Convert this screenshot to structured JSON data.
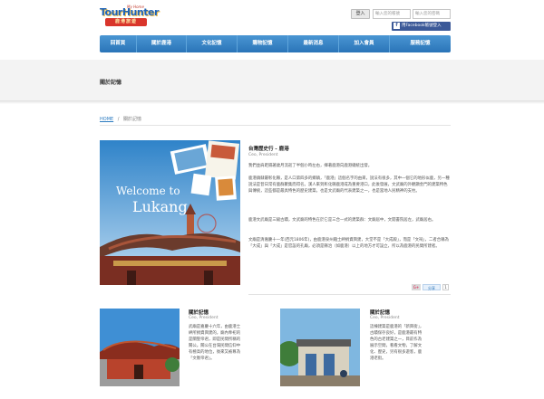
{
  "header": {
    "logo": {
      "main": "TourHunter",
      "tag": "My Home",
      "sub": "鹿港旅遊"
    },
    "login_button": "登入",
    "account_placeholder": "輸入您的帳號",
    "password_placeholder": "輸入您的密碼",
    "facebook_login": "用Facebook帳號登入"
  },
  "nav": {
    "items": [
      "回首頁",
      "關於鹿港",
      "文化記憶",
      "購物記憶",
      "最新消息",
      "加入會員",
      "服務記憶"
    ]
  },
  "page_title": "關於記憶",
  "breadcrumb": {
    "home": "HOME",
    "separator": "/",
    "current": "關於記憶"
  },
  "feature": {
    "image_caption_1": "Welcome to",
    "image_caption_2": "Lukang",
    "title": "台灣歷史行 - 鹿港",
    "subtitle": "Ceo, President",
    "paragraphs": [
      "我們並肩距隔著歲月流逝了半個小時左右，揮著鹿港向鹿港總統出發。",
      "鹿港鎮隸屬彰化縣，是人口第四多的鄉鎮，「鹿港」這個名字的由來，說法有很多，其中一個它的地形似鹿，另一種說法是昔日常有鹿群聚集而得名。漢人來到彰化縣鹿港成為重要港口，此後發展，文武廟的外觀顯金門的建築特色與傳統，這些都是最具特色的歷史建築，也是文武廟的代表建築之一，也是當地人民精神的支柱。",
      "鹿港文武廟是三級古蹟，文武廟的特色在於它是三合一式的建築群：文廟居中，文開書院居左，武廟居右。",
      "文廟是清嘉慶十一年(西元1806年)，由鹿港泉州籍士紳捐資興建，大堂不是「大成殿」，而是「文祠」，二者合稱為「大成」與「大成」是官設的孔廟，必須是縣治（如鹿港）以上的地方才可設立，所以為鹿港的民間所建者。"
    ]
  },
  "share": {
    "g": "G+",
    "share": "分享",
    "count": "1"
  },
  "cards": [
    {
      "title": "關於記憶",
      "subtitle": "Ceo, President",
      "text": "武廟是嘉慶十六年，由鹿港士紳所捐資興建的，廟內奉祀的是關聖帝君，即是民間所稱的關公。關公在台灣民間信仰中有極高的地位，後來又被尊為「文衡帝君」。"
    },
    {
      "title": "關於記憶",
      "subtitle": "Ceo, President",
      "text": "這棟建築是鹿港的「新興街」，古蹟保存良好，是鹿港最有特色的古老建築之一，目前作為展示空間，看看文物，了解文化、歷史，另有很多遊客，鹿港老街。"
    }
  ]
}
